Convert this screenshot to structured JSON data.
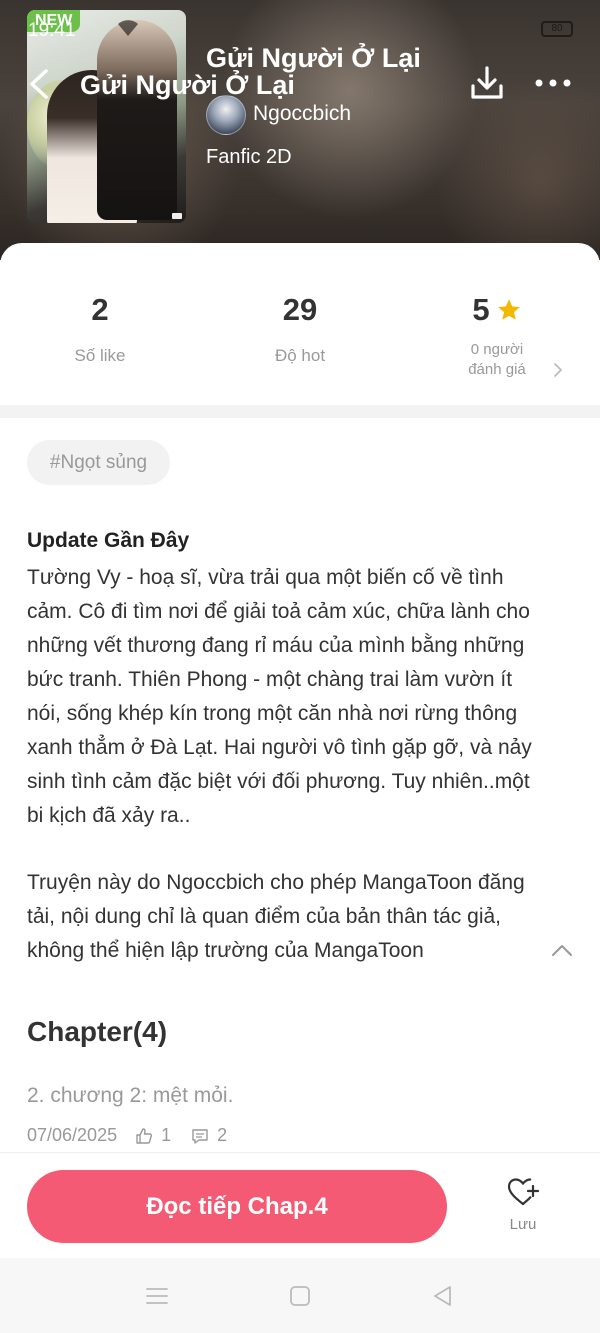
{
  "status_bar": {
    "time": "19:41",
    "battery": "80"
  },
  "header": {
    "new_badge": "NEW",
    "nav_title": "Gửi Người Ở Lại",
    "title": "Gửi Người Ở Lại",
    "author": "Ngoccbich",
    "genre": "Fanfic 2D"
  },
  "stats": {
    "likes": {
      "value": "2",
      "label": "Số like"
    },
    "hot": {
      "value": "29",
      "label": "Độ hot"
    },
    "rating": {
      "value": "5",
      "label_line1": "0 người",
      "label_line2": "đánh giá"
    }
  },
  "tag": "#Ngọt sủng",
  "description": {
    "heading": "Update Gần Đây",
    "body": "Tường Vy - hoạ sĩ, vừa trải qua một biến cố về tình cảm. Cô đi tìm nơi để giải toả cảm xúc, chữa lành cho những vết thương đang rỉ máu của mình bằng những bức tranh. Thiên Phong - một chàng trai làm vườn ít nói, sống khép kín trong một căn nhà nơi rừng thông xanh thẳm ở Đà Lạt. Hai người vô tình gặp gỡ, và nảy sinh tình cảm đặc biệt với đối phương. Tuy nhiên..một bi kịch đã xảy ra..",
    "disclaimer": "Truyện này do Ngoccbich cho phép MangaToon đăng tải, nội dung chỉ là quan điểm của bản thân tác giả, không thể hiện lập trường của MangaToon"
  },
  "chapters": {
    "heading": "Chapter(4)",
    "latest": {
      "title": "2. chương 2: mệt mỏi.",
      "date": "07/06/2025",
      "likes": "1",
      "comments": "2"
    }
  },
  "actions": {
    "read_label": "Đọc tiếp Chap.4",
    "save_label": "Lưu"
  },
  "colors": {
    "accent": "#f45a74",
    "star": "#f5b800",
    "new_badge": "#6cc04a"
  }
}
